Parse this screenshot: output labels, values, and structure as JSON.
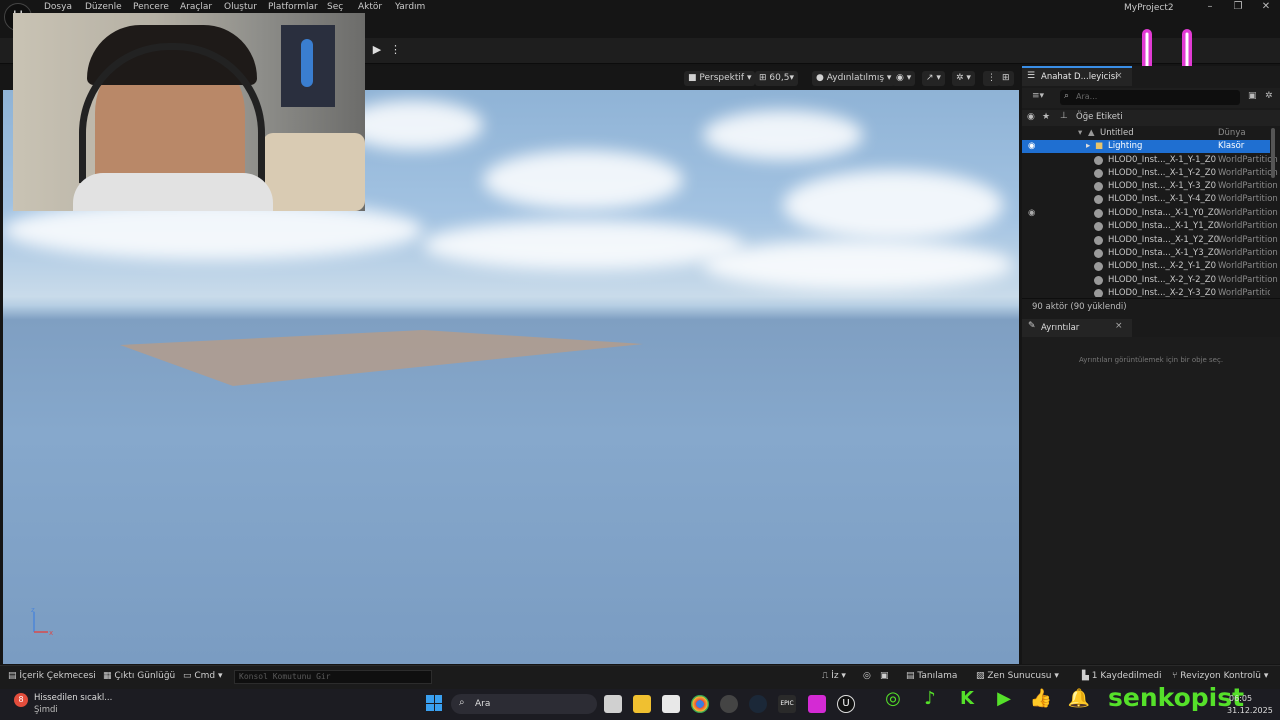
{
  "menu": {
    "items": [
      "Dosya",
      "Düzenle",
      "Pencere",
      "Araçlar",
      "Oluştur",
      "Platformlar",
      "Seç",
      "Aktör",
      "Yardım"
    ],
    "project": "MyProject2"
  },
  "viewport": {
    "perspective": "Perspektif",
    "fov": "60,5",
    "lighting": "Aydınlatılmış"
  },
  "outliner": {
    "tab_label": "Anahat D...leyicisi",
    "search_placeholder": "Ara...",
    "column_label": "Öğe Etiketi",
    "rows": [
      {
        "label": "Untitled",
        "type": "Dünya"
      },
      {
        "label": "Lighting",
        "type": "Klasör"
      },
      {
        "label": "HLOD0_Inst..._X-1_Y-1_Z0",
        "type": "WorldPartition"
      },
      {
        "label": "HLOD0_Inst..._X-1_Y-2_Z0",
        "type": "WorldPartition"
      },
      {
        "label": "HLOD0_Inst..._X-1_Y-3_Z0",
        "type": "WorldPartition"
      },
      {
        "label": "HLOD0_Inst..._X-1_Y-4_Z0",
        "type": "WorldPartition"
      },
      {
        "label": "HLOD0_Insta..._X-1_Y0_Z0",
        "type": "WorldPartition"
      },
      {
        "label": "HLOD0_Insta..._X-1_Y1_Z0",
        "type": "WorldPartition"
      },
      {
        "label": "HLOD0_Insta..._X-1_Y2_Z0",
        "type": "WorldPartition"
      },
      {
        "label": "HLOD0_Insta..._X-1_Y3_Z0",
        "type": "WorldPartition"
      },
      {
        "label": "HLOD0_Inst..._X-2_Y-1_Z0",
        "type": "WorldPartition"
      },
      {
        "label": "HLOD0_Inst..._X-2_Y-2_Z0",
        "type": "WorldPartition"
      },
      {
        "label": "HLOD0_Inst..._X-2_Y-3_Z0",
        "type": "WorldPartition"
      }
    ],
    "footer": "90 aktör (90 yüklendi)"
  },
  "details": {
    "tab_label": "Ayrıntılar",
    "empty_message": "Ayrıntıları görüntülemek için bir obje seç."
  },
  "statusbar": {
    "content_drawer": "İçerik Çekmecesi",
    "output_log": "Çıktı Günlüğü",
    "cmd": "Cmd",
    "console_placeholder": "Konsol Komutunu Gir",
    "trace": "İz",
    "diagnostics": "Tanılama",
    "zen_server": "Zen Sunucusu",
    "unsaved": "1 Kaydedilmedi",
    "revision": "Revizyon Kontrolü"
  },
  "taskbar": {
    "weather_title": "Hissedilen sıcakl...",
    "weather_sub": "Şimdi",
    "weather_badge": "8",
    "search_label": "Ara",
    "time": "06:05",
    "date": "31.12.2025"
  },
  "overlay": {
    "channel": "senkopist",
    "accent": "#55e02a",
    "smiley_color": "#e23bd4"
  }
}
